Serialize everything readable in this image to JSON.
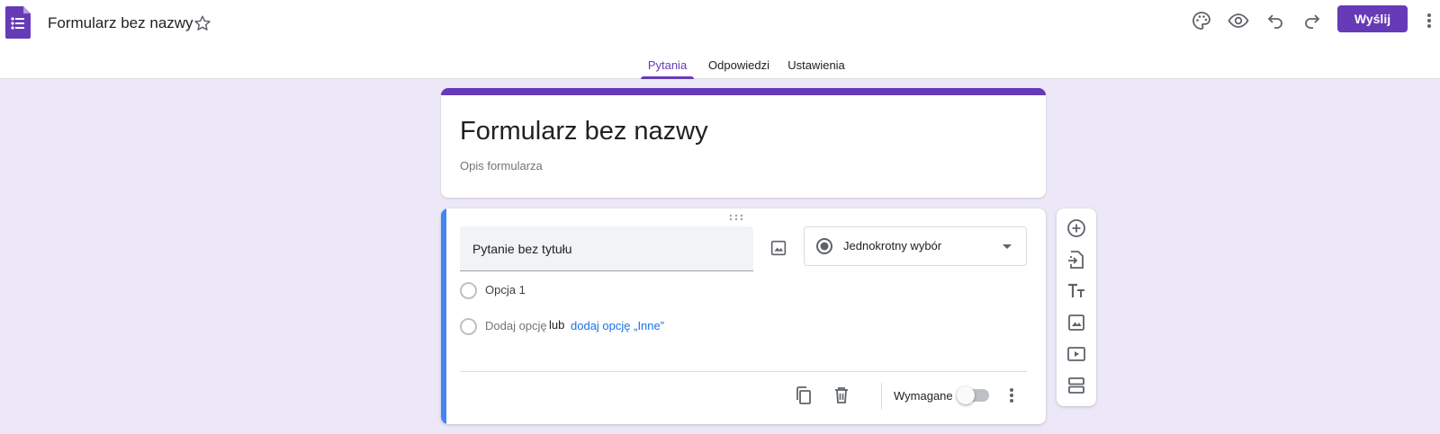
{
  "header": {
    "title": "Formularz bez nazwy",
    "send_label": "Wyślij",
    "icons": [
      "palette-icon",
      "eye-icon",
      "undo-icon",
      "redo-icon",
      "more-vert-icon"
    ]
  },
  "tabs": [
    {
      "label": "Pytania",
      "active": true
    },
    {
      "label": "Odpowiedzi",
      "active": false
    },
    {
      "label": "Ustawienia",
      "active": false
    }
  ],
  "form": {
    "title": "Formularz bez nazwy",
    "description_placeholder": "Opis formularza"
  },
  "question": {
    "title_placeholder": "Pytanie bez tytułu",
    "type": "Jednokrotny wybór",
    "options": [
      "Opcja 1"
    ],
    "add_option": "Dodaj opcję",
    "or_text": "lub",
    "add_other": "dodaj opcję „Inne”",
    "required_label": "Wymagane",
    "required": false
  },
  "side_toolbar": [
    "add-question-icon",
    "import-questions-icon",
    "title-text-icon",
    "image-icon",
    "video-icon",
    "section-icon"
  ],
  "colors": {
    "accent": "#673ab7",
    "background": "#ede8f7",
    "focus_bar": "#4285f4",
    "link": "#1a73e8"
  }
}
